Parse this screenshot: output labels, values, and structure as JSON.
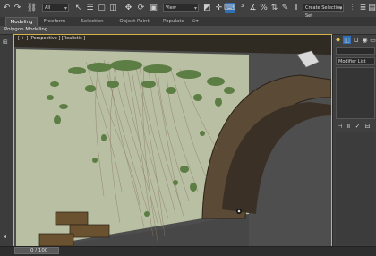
{
  "toolbar": {
    "filter_selection": "All",
    "reference_coordinate": "View",
    "named_selection_sets": "Create Selection Set"
  },
  "ribbon": {
    "tabs": [
      {
        "label": "Modeling",
        "active": true
      },
      {
        "label": "Freeform",
        "active": false
      },
      {
        "label": "Selection",
        "active": false
      },
      {
        "label": "Object Paint",
        "active": false
      },
      {
        "label": "Populate",
        "active": false
      }
    ],
    "more_label": "⊙▾",
    "sub_label": "Polygon Modeling"
  },
  "viewport": {
    "label": "[ + ] [Perspective ] [Realistic ]"
  },
  "command_panel": {
    "modifier_list_label": "Modifier List"
  },
  "timeline": {
    "frame_counter": "0 / 100"
  },
  "colors": {
    "accent": "#d6b24a",
    "wall": "#b9bfa2",
    "floor": "#4b4b4b",
    "arch": "#5a4a36",
    "ivy_leaf": "#5c7d43",
    "vine": "#8a7a66",
    "brick": "#6a5130"
  }
}
